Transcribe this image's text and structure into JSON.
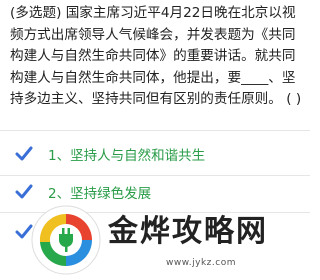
{
  "question": {
    "text": "(多选题)  国家主席习近平4月22日晚在北京以视频方式出席领导人气候峰会，并发表题为《共同构建人与自然生命共同体》的重要讲话。就共同构建人与自然生命共同体，他提出，要____、坚持多边主义、坚持共同但有区别的责任原则。  (    )"
  },
  "options": [
    {
      "label": "1、坚持人与自然和谐共生",
      "checked": true
    },
    {
      "label": "2、坚持绿色发展",
      "checked": true
    }
  ],
  "colors": {
    "check": "#3a6fd8",
    "option_text": "#2a9c48"
  },
  "watermark": {
    "title": "金烨攻略网",
    "url": "www.jykz.com"
  }
}
